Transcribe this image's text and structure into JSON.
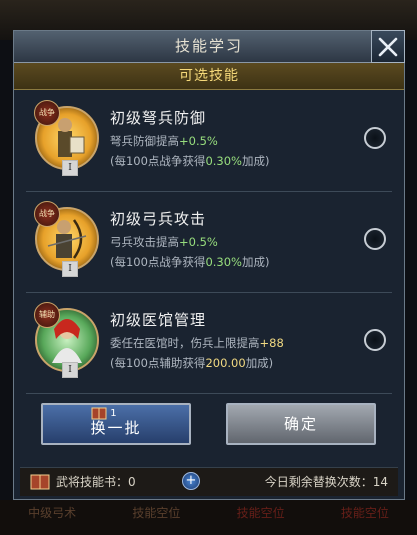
{
  "background": {
    "tabs": [
      "中级弓术",
      "技能空位",
      "技能空位",
      "技能空位"
    ]
  },
  "dialog": {
    "title": "技能学习",
    "subtitle": "可选技能",
    "close_icon": "close-x-icon"
  },
  "skills": [
    {
      "tag": "战争",
      "level": "I",
      "name": "初级弩兵防御",
      "line1_prefix": "弩兵防御提高",
      "line1_value": "+0.5%",
      "line2_prefix": "(每100点战争获得",
      "line2_value": "0.30%",
      "line2_suffix": "加成)",
      "icon": "crossbow-soldier-portrait"
    },
    {
      "tag": "战争",
      "level": "I",
      "name": "初级弓兵攻击",
      "line1_prefix": "弓兵攻击提高",
      "line1_value": "+0.5%",
      "line2_prefix": "(每100点战争获得",
      "line2_value": "0.30%",
      "line2_suffix": "加成)",
      "icon": "archer-portrait"
    },
    {
      "tag": "辅助",
      "level": "I",
      "name": "初级医馆管理",
      "line1_prefix": "委任在医馆时，伤兵上限提高",
      "line1_value": "+88",
      "line2_prefix": "(每100点辅助获得",
      "line2_value": "200.00",
      "line2_suffix": "加成)",
      "icon": "medic-portrait"
    }
  ],
  "buttons": {
    "refresh_label": "换一批",
    "refresh_cost": "1",
    "confirm_label": "确定"
  },
  "footer": {
    "skill_books_label": "武将技能书：",
    "skill_books_count": "0",
    "remaining_label": "今日剩余替换次数：",
    "remaining_count": "14"
  },
  "colors": {
    "accent_gold": "#f5d97a",
    "highlight_green": "#97dd7d",
    "highlight_yellow": "#f1d982",
    "refresh_blue": "#4b6fa8"
  }
}
